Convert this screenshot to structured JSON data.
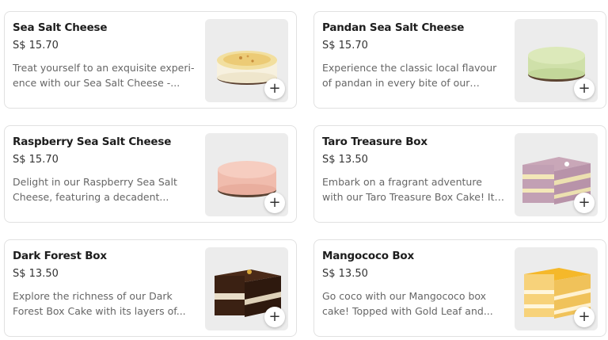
{
  "products": [
    {
      "name": "Sea Salt Cheese",
      "price": "S$ 15.70",
      "description": "Treat yourself to an exquisite experi-ence with our Sea Salt Cheese -...",
      "image": "sea-salt-cheese-cake",
      "add_label": "+"
    },
    {
      "name": "Pandan Sea Salt Cheese",
      "price": "S$ 15.70",
      "description": "Experience the classic local flavour of pandan in every bite of our Pandan...",
      "image": "pandan-sea-salt-cheese-cake",
      "add_label": "+"
    },
    {
      "name": "Raspberry Sea Salt Cheese",
      "price": "S$ 15.70",
      "description": "Delight in our Raspberry Sea Salt Cheese, featuring a decadent...",
      "image": "raspberry-sea-salt-cheese-cake",
      "add_label": "+"
    },
    {
      "name": "Taro Treasure Box",
      "price": "S$ 13.50",
      "description": "Embark on a fragrant adventure with our Taro Treasure Box Cake! It's a de...",
      "image": "taro-treasure-box-cake",
      "add_label": "+"
    },
    {
      "name": "Dark Forest Box",
      "price": "S$ 13.50",
      "description": "Explore the richness of our Dark Forest Box Cake with its layers of...",
      "image": "dark-forest-box-cake",
      "add_label": "+"
    },
    {
      "name": "Mangococo Box",
      "price": "S$ 13.50",
      "description": "Go coco with our Mangococo box cake! Topped with Gold Leaf and...",
      "image": "mangococo-box-cake",
      "add_label": "+"
    }
  ],
  "icons": {
    "add": "plus-icon"
  },
  "colors": {
    "card_border": "#e1e1e1",
    "name_text": "#1d1d1d",
    "desc_text": "#666666",
    "thumb_bg": "#ececec"
  }
}
